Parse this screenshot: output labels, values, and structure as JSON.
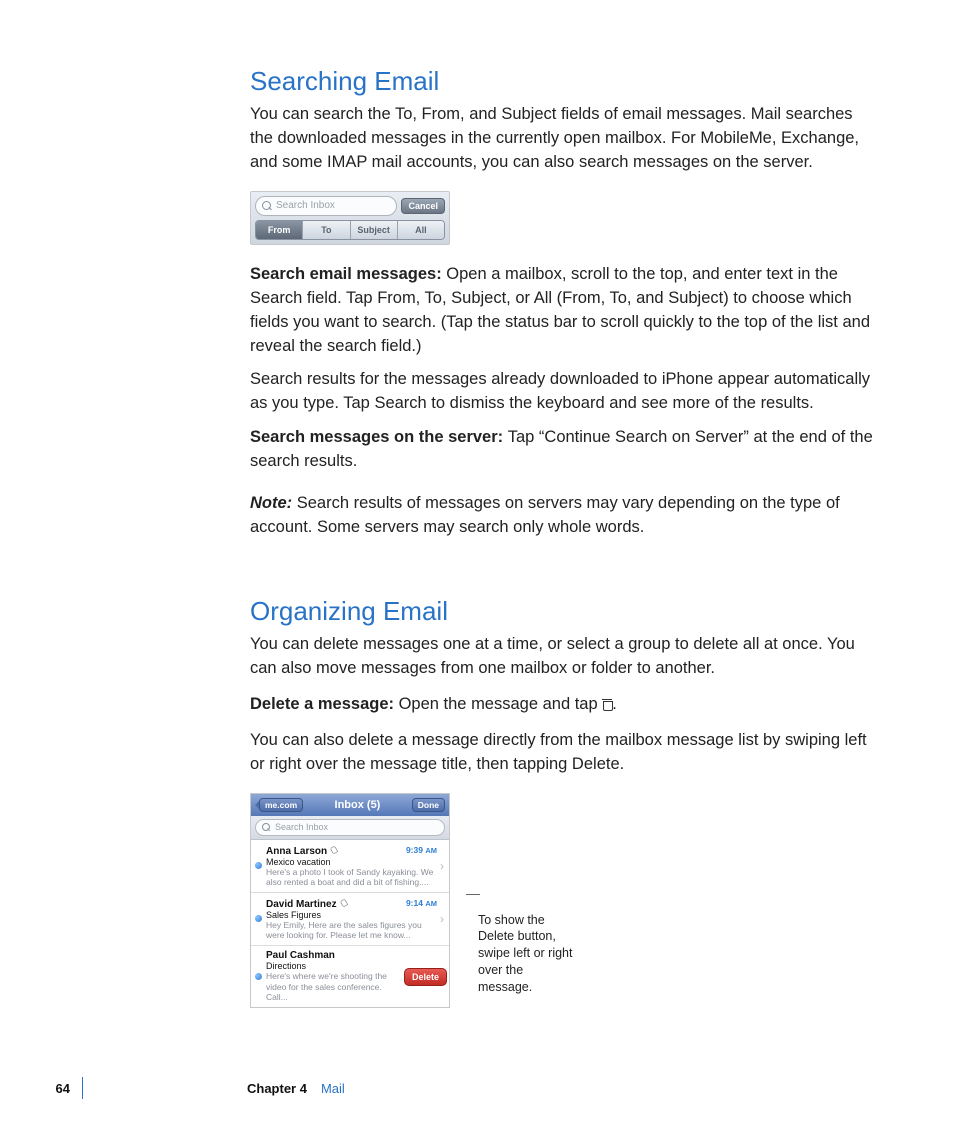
{
  "section1": {
    "heading": "Searching Email",
    "intro": "You can search the To, From, and Subject fields of email messages. Mail searches the downloaded messages in the currently open mailbox. For MobileMe, Exchange, and some IMAP mail accounts, you can also search messages on the server.",
    "search_widget": {
      "placeholder": "Search Inbox",
      "cancel": "Cancel",
      "tabs": {
        "from": "From",
        "to": "To",
        "subject": "Subject",
        "all": "All"
      }
    },
    "p1_lead": "Search email messages:  ",
    "p1_body": "Open a mailbox, scroll to the top, and enter text in the Search field. Tap From, To, Subject, or All (From, To, and Subject) to choose which fields you want to search. (Tap the status bar to scroll quickly to the top of the list and reveal the search field.)",
    "p2": "Search results for the messages already downloaded to iPhone appear automatically as you type. Tap Search to dismiss the keyboard and see more of the results.",
    "p3_lead": "Search messages on the server:  ",
    "p3_body": "Tap “Continue Search on Server” at the end of the search results.",
    "note_lead": "Note:  ",
    "note_body": "Search results of messages on servers may vary depending on the type of account. Some servers may search only whole words."
  },
  "section2": {
    "heading": "Organizing Email",
    "intro": "You can delete messages one at a time, or select a group to delete all at once. You can also move messages from one mailbox or folder to another.",
    "p1_lead": "Delete a message:  ",
    "p1_body_a": "Open the message and tap ",
    "p1_body_b": ".",
    "p2": "You can also delete a message directly from the mailbox message list by swiping left or right over the message title, then tapping Delete.",
    "inbox": {
      "back": "me.com",
      "title": "Inbox (5)",
      "done": "Done",
      "search_placeholder": "Search Inbox",
      "messages": [
        {
          "sender": "Anna Larson",
          "has_attachment": true,
          "time": "9:39",
          "ampm": "AM",
          "subject": "Mexico vacation",
          "preview": "Here's a photo I took of Sandy kayaking. We also rented a boat and did a bit of fishing...."
        },
        {
          "sender": "David Martinez",
          "has_attachment": true,
          "time": "9:14",
          "ampm": "AM",
          "subject": "Sales Figures",
          "preview": "Hey Emily, Here are the sales figures you were looking for. Please let me know..."
        },
        {
          "sender": "Paul Cashman",
          "has_attachment": false,
          "time": "",
          "ampm": "",
          "subject": "Directions",
          "preview": "Here's where we're shooting the video for the sales conference. Call..."
        }
      ],
      "delete_label": "Delete"
    },
    "callout": "To show the Delete button, swipe left or right over the message."
  },
  "footer": {
    "page": "64",
    "chapter": "Chapter 4",
    "title": "Mail"
  }
}
